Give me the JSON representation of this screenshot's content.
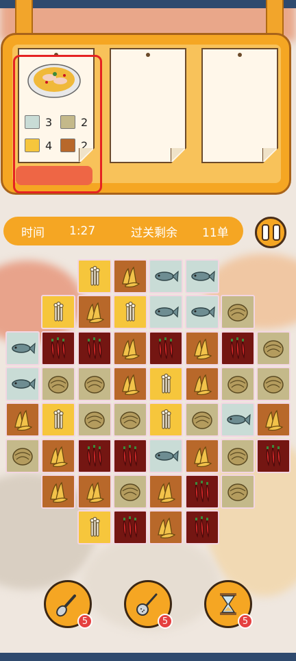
{
  "header": {
    "time_label": "时间",
    "time_value": "1:27",
    "remaining_label": "过关剩余",
    "remaining_value": "11单"
  },
  "order": {
    "requirements": [
      {
        "ingredient": "fish",
        "count": "3"
      },
      {
        "ingredient": "cabbage",
        "count": "2"
      },
      {
        "ingredient": "mushroom",
        "count": "4"
      },
      {
        "ingredient": "ginger",
        "count": "2"
      }
    ]
  },
  "ingredients": {
    "fish": {
      "bg": "#c9dcd6",
      "icon": "fish-icon"
    },
    "cabbage": {
      "bg": "#c4b98a",
      "icon": "cabbage-icon"
    },
    "mushroom": {
      "bg": "#f6c63c",
      "icon": "mushroom-icon"
    },
    "ginger": {
      "bg": "#b8682a",
      "icon": "ginger-icon"
    },
    "chili": {
      "bg": "#741612",
      "icon": "chili-icon"
    }
  },
  "board_rows": [
    [
      null,
      null,
      "mushroom",
      "ginger",
      "fish",
      "fish",
      null,
      null
    ],
    [
      null,
      "mushroom",
      "ginger",
      "mushroom",
      "fish",
      "fish",
      "cabbage",
      null
    ],
    [
      "fish",
      "chili",
      "chili",
      "ginger",
      "chili",
      "ginger",
      "chili",
      "cabbage"
    ],
    [
      "fish",
      "cabbage",
      "cabbage",
      "ginger",
      "mushroom",
      "ginger",
      "cabbage",
      "cabbage"
    ],
    [
      "ginger",
      "mushroom",
      "cabbage",
      "cabbage",
      "mushroom",
      "cabbage",
      "fish",
      "ginger"
    ],
    [
      "cabbage",
      "ginger",
      "chili",
      "chili",
      "fish",
      "ginger",
      "cabbage",
      "chili"
    ],
    [
      null,
      "ginger",
      "ginger",
      "cabbage",
      "ginger",
      "chili",
      "cabbage",
      null
    ],
    [
      null,
      null,
      "mushroom",
      "chili",
      "ginger",
      "chili",
      null,
      null
    ]
  ],
  "tools": [
    {
      "name": "spoon",
      "icon": "spoon-icon",
      "count": "5"
    },
    {
      "name": "ladle",
      "icon": "ladle-icon",
      "count": "5"
    },
    {
      "name": "hourglass",
      "icon": "hourglass-icon",
      "count": "5"
    }
  ]
}
